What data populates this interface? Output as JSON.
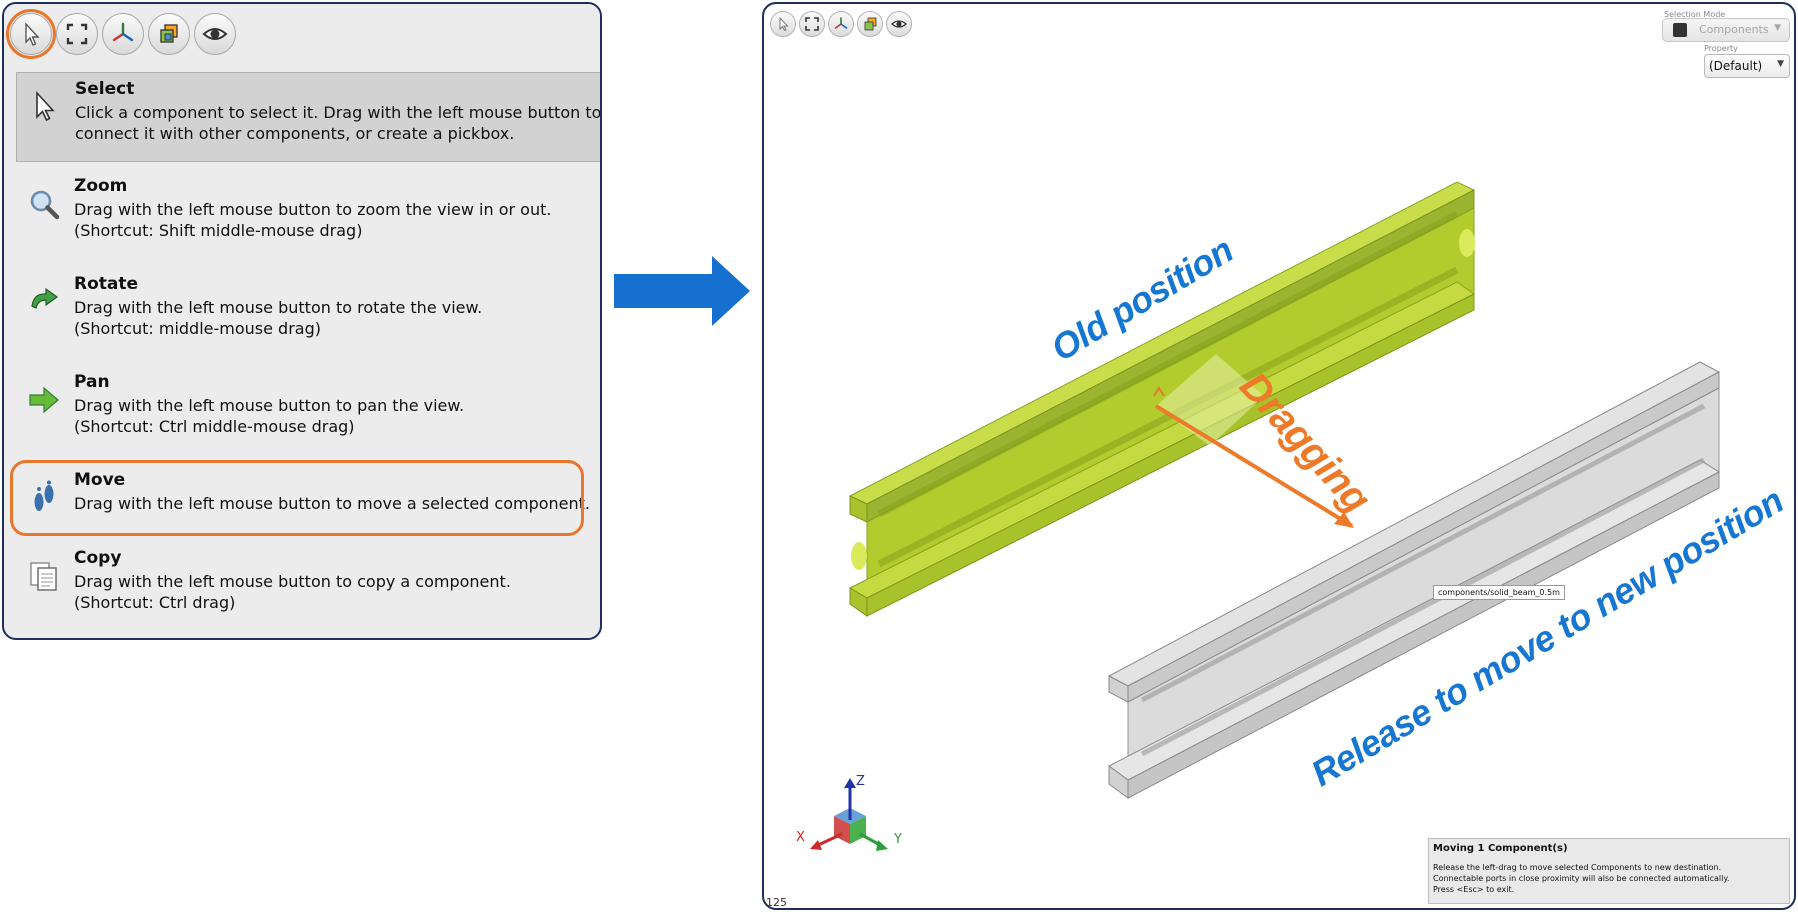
{
  "left_panel": {
    "toolbar": [
      {
        "name": "select-tool-button",
        "icon": "cursor-icon",
        "active": true
      },
      {
        "name": "fit-view-button",
        "icon": "fit-view-icon"
      },
      {
        "name": "axes-view-button",
        "icon": "axes-icon"
      },
      {
        "name": "view-style-button",
        "icon": "cubes-icon"
      },
      {
        "name": "visibility-button",
        "icon": "eye-icon"
      }
    ],
    "tools": [
      {
        "id": "select",
        "title": "Select",
        "description": "Click a component to select it. Drag with the left mouse button to mov\nconnect it with other components, or create a pickbox.",
        "icon": "cursor-icon",
        "selected": true
      },
      {
        "id": "zoom",
        "title": "Zoom",
        "description": "Drag with the left mouse button to zoom the view in or out.\n(Shortcut: Shift middle-mouse drag)",
        "icon": "magnifier-icon"
      },
      {
        "id": "rotate",
        "title": "Rotate",
        "description": "Drag with the left mouse button to rotate the view.\n(Shortcut: middle-mouse drag)",
        "icon": "rotate-arrow-icon"
      },
      {
        "id": "pan",
        "title": "Pan",
        "description": "Drag with the left mouse button to pan the view.\n(Shortcut: Ctrl middle-mouse drag)",
        "icon": "right-arrow-icon"
      },
      {
        "id": "move",
        "title": "Move",
        "description": "Drag with the left mouse button to move a selected component.",
        "icon": "footprints-icon",
        "highlighted": true
      },
      {
        "id": "copy",
        "title": "Copy",
        "description": "Drag with the left mouse button to copy a component.\n(Shortcut: Ctrl drag)",
        "icon": "copy-pages-icon"
      }
    ]
  },
  "viewport": {
    "selection_mode_label": "Selection Mode",
    "selection_mode_value": "Components",
    "property_label": "Property",
    "property_value": "(Default)",
    "annotations": {
      "old": "Old position",
      "dragging": "Dragging",
      "release": "Release to move to new position"
    },
    "tooltip": "components/solid_beam_0.5m",
    "info": {
      "title": "Moving 1 Component(s)",
      "lines": [
        "Release the left-drag to move selected Components to new destination.",
        "Connectable ports in close proximity will also be connected automatically.",
        "Press <Esc> to exit."
      ]
    },
    "axes": {
      "x": "X",
      "y": "Y",
      "z": "Z"
    },
    "corner_number": "125"
  },
  "colors": {
    "highlight_orange": "#e8762c",
    "annotation_blue": "#1677d3",
    "beam_green": "#b5cf2c",
    "beam_gray": "#cdcdcd",
    "frame_navy": "#1c2e5c"
  }
}
